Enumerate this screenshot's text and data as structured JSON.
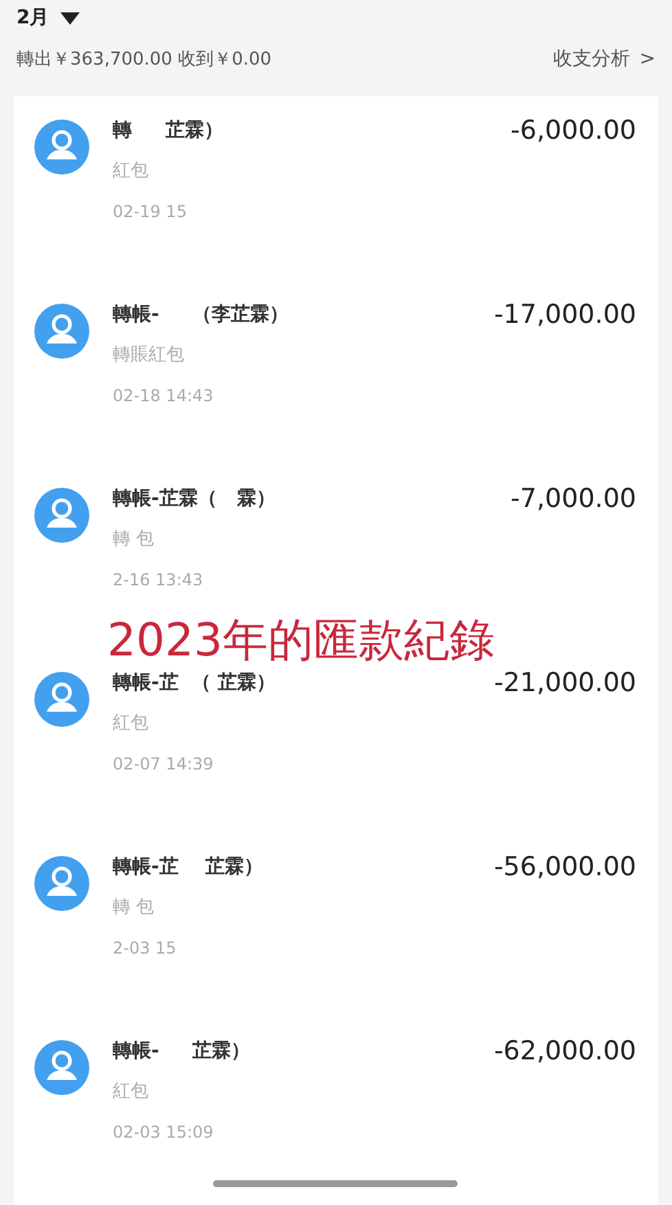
{
  "header": {
    "month": "2月",
    "summary": "轉出￥363,700.00 收到￥0.00",
    "analysis_link": "收支分析",
    "chevron": ">"
  },
  "transactions": [
    {
      "title": "轉     芷霖）",
      "note": "紅包",
      "time": "02-19 15",
      "amount": "-6,000.00"
    },
    {
      "title": "轉帳-     （李芷霖）",
      "note": "轉賬紅包",
      "time": "02-18 14:43",
      "amount": "-17,000.00"
    },
    {
      "title": "轉帳-芷霖（   霖）",
      "note": "轉  包",
      "time": "2-16 13:43",
      "amount": "-7,000.00"
    },
    {
      "title": "轉帳-芷  （ 芷霖）",
      "note": "紅包",
      "time": "02-07 14:39",
      "amount": "-21,000.00"
    },
    {
      "title": "轉帳-芷    芷霖）",
      "note": "轉  包",
      "time": "2-03 15",
      "amount": "-56,000.00"
    },
    {
      "title": "轉帳-     芷霖）",
      "note": "紅包",
      "time": "02-03 15:09",
      "amount": "-62,000.00"
    }
  ],
  "caption": "2023年的匯款紀錄"
}
